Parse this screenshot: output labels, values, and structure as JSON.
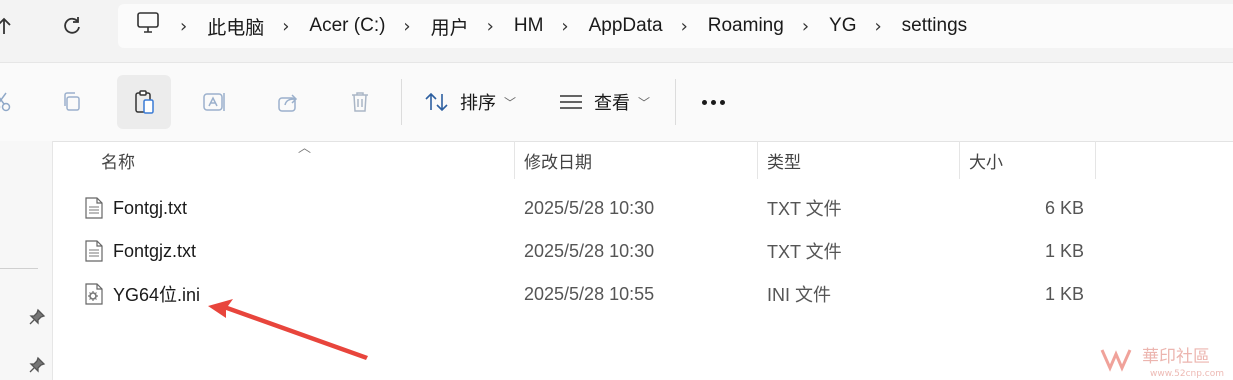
{
  "nav": {
    "breadcrumbs": [
      "此电脑",
      "Acer (C:)",
      "用户",
      "HM",
      "AppData",
      "Roaming",
      "YG",
      "settings"
    ]
  },
  "toolbar": {
    "sort_label": "排序",
    "view_label": "查看"
  },
  "columns": {
    "name": "名称",
    "date": "修改日期",
    "type": "类型",
    "size": "大小"
  },
  "files": [
    {
      "name": "Fontgj.txt",
      "date": "2025/5/28 10:30",
      "type": "TXT 文件",
      "size": "6 KB",
      "icon": "text-file-icon"
    },
    {
      "name": "Fontgjz.txt",
      "date": "2025/5/28 10:30",
      "type": "TXT 文件",
      "size": "1 KB",
      "icon": "text-file-icon"
    },
    {
      "name": "YG64位.ini",
      "date": "2025/5/28 10:55",
      "type": "INI 文件",
      "size": "1 KB",
      "icon": "settings-file-icon"
    }
  ],
  "annotation": {
    "arrow_color": "#e8453c"
  },
  "watermark": {
    "text": "華印社區",
    "url": "www.52cnp.com"
  }
}
